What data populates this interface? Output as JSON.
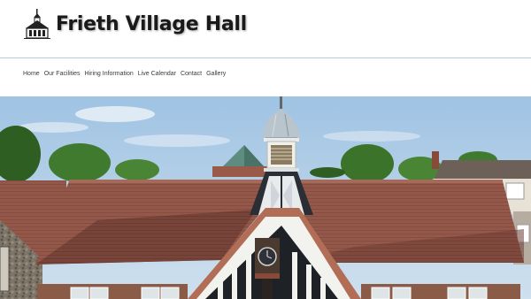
{
  "site": {
    "title": "Frieth Village Hall",
    "logo_icon": "village-hall-icon"
  },
  "nav": {
    "items": [
      {
        "label": "Home"
      },
      {
        "label": "Our Facilities"
      },
      {
        "label": "Hiring Information"
      },
      {
        "label": "Live Calendar"
      },
      {
        "label": "Contact"
      },
      {
        "label": "Gallery"
      }
    ]
  },
  "hero": {
    "image": "village-hall-aerial-photo"
  },
  "colors": {
    "title_text": "#1a1a1a",
    "nav_text": "#3a3a3a",
    "header_rule": "#b8cbe0",
    "sky": "#a9cbe6",
    "roof": "#9a5a4a",
    "trees": "#3f7a2e"
  }
}
